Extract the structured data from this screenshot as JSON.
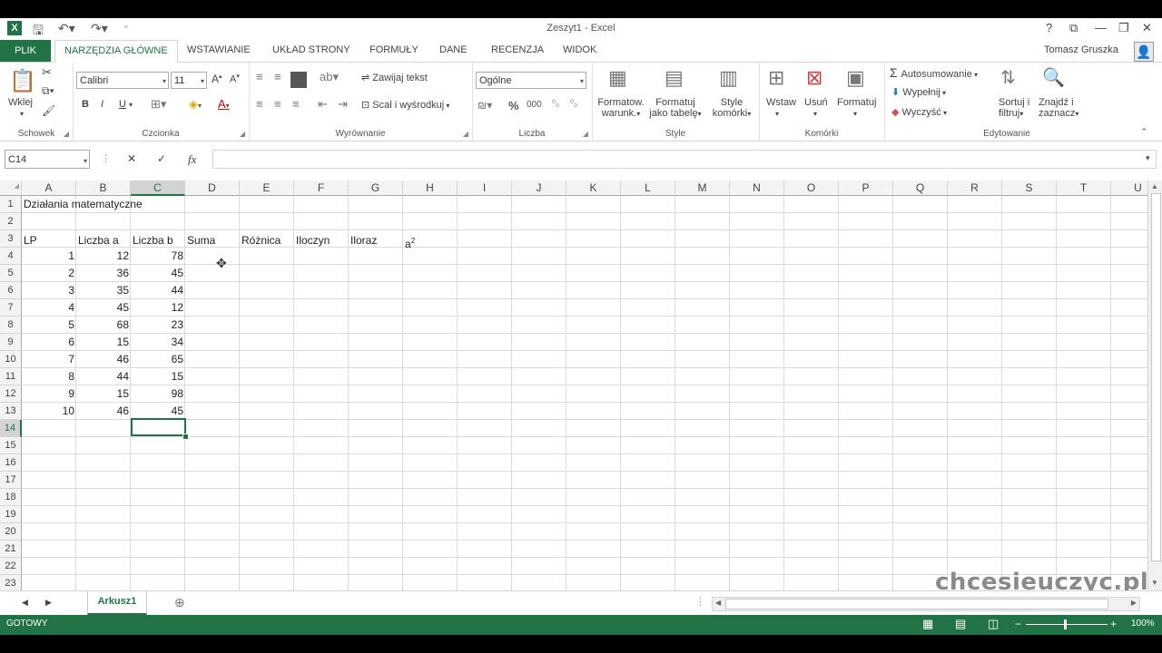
{
  "window": {
    "title": "Zeszyt1 - Excel",
    "help": "?",
    "user": "Tomasz Gruszka"
  },
  "qat": {
    "save_icon": "save-icon",
    "undo_icon": "undo-icon",
    "redo_icon": "redo-icon"
  },
  "tabs": [
    "PLIK",
    "NARZĘDZIA GŁÓWNE",
    "WSTAWIANIE",
    "UKŁAD STRONY",
    "FORMUŁY",
    "DANE",
    "RECENZJA",
    "WIDOK"
  ],
  "ribbon": {
    "clipboard": {
      "paste": "Wklej",
      "label": "Schowek"
    },
    "font": {
      "name": "Calibri",
      "size": "11",
      "bold": "B",
      "italic": "I",
      "underline": "U",
      "label": "Czcionka"
    },
    "alignment": {
      "wrap": "Zawijaj tekst",
      "merge": "Scal i wyśrodkuj",
      "label": "Wyrównanie"
    },
    "number": {
      "format": "Ogólne",
      "percent": "%",
      "thousands": "000",
      "label": "Liczba"
    },
    "styles": {
      "cond1": "Formatow.",
      "cond2": "warunk.",
      "table1": "Formatuj",
      "table2": "jako tabelę",
      "cell1": "Style",
      "cell2": "komórki",
      "label": "Style"
    },
    "cells": {
      "insert": "Wstaw",
      "delete": "Usuń",
      "format": "Formatuj",
      "label": "Komórki"
    },
    "editing": {
      "autosum": "Autosumowanie",
      "fill": "Wypełnij",
      "clear": "Wyczyść",
      "sort1": "Sortuj i",
      "sort2": "filtruj",
      "find1": "Znajdź i",
      "find2": "zaznacz",
      "label": "Edytowanie"
    }
  },
  "formula_bar": {
    "name_box": "C14",
    "cancel": "✕",
    "enter": "✓",
    "fx": "fx",
    "value": ""
  },
  "columns": [
    "A",
    "B",
    "C",
    "D",
    "E",
    "F",
    "G",
    "H",
    "I",
    "J",
    "K",
    "L",
    "M",
    "N",
    "O",
    "P",
    "Q",
    "R",
    "S",
    "T",
    "U"
  ],
  "rows": [
    "1",
    "2",
    "3",
    "4",
    "5",
    "6",
    "7",
    "8",
    "9",
    "10",
    "11",
    "12",
    "13",
    "14",
    "15",
    "16",
    "17",
    "18",
    "19",
    "20",
    "21",
    "22",
    "23"
  ],
  "sheet": {
    "title": "Działania matematyczne",
    "headers": {
      "lp": "LP",
      "a": "Liczba a",
      "b": "Liczba b",
      "sum": "Suma",
      "diff": "Różnica",
      "prod": "Iloczyn",
      "quot": "Iloraz",
      "sq": "a",
      "sq_exp": "2"
    },
    "data": [
      {
        "lp": "1",
        "a": "12",
        "b": "78"
      },
      {
        "lp": "2",
        "a": "36",
        "b": "45"
      },
      {
        "lp": "3",
        "a": "35",
        "b": "44"
      },
      {
        "lp": "4",
        "a": "45",
        "b": "12"
      },
      {
        "lp": "5",
        "a": "68",
        "b": "23"
      },
      {
        "lp": "6",
        "a": "15",
        "b": "34"
      },
      {
        "lp": "7",
        "a": "46",
        "b": "65"
      },
      {
        "lp": "8",
        "a": "44",
        "b": "15"
      },
      {
        "lp": "9",
        "a": "15",
        "b": "98"
      },
      {
        "lp": "10",
        "a": "46",
        "b": "45"
      }
    ]
  },
  "sheet_tabs": {
    "active": "Arkusz1"
  },
  "watermark": "chcesieuczyc.pl",
  "status": {
    "mode": "GOTOWY",
    "zoom": "100%"
  },
  "colors": {
    "accent": "#217346",
    "selection": "#217346"
  }
}
